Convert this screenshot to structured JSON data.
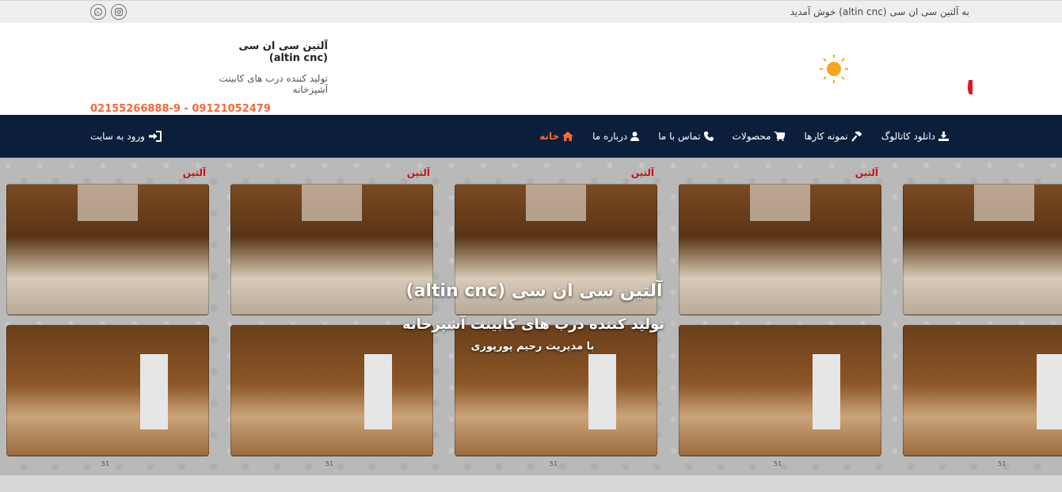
{
  "topbar": {
    "welcome": "به آلتین سی ان سی (altin cnc) خوش آمدید",
    "social": [
      {
        "icon": "instagram-icon"
      },
      {
        "icon": "whatsapp-icon"
      }
    ]
  },
  "header": {
    "logo_text": "آلتین",
    "site_name": "آلتین سی ان سی (altin cnc)",
    "tagline": "تولید کننده درب های کابینت آشپزخانه",
    "phones": "02155266888-9 - 09121052479"
  },
  "nav": {
    "items": [
      {
        "label": "خانه",
        "icon": "home-icon",
        "active": true
      },
      {
        "label": "درباره ما",
        "icon": "user-icon"
      },
      {
        "label": "تماس با ما",
        "icon": "phone-icon"
      },
      {
        "label": "محصولات",
        "icon": "cart-icon"
      },
      {
        "label": "نمونه کارها",
        "icon": "gavel-icon"
      },
      {
        "label": "دانلود کاتالوگ",
        "icon": "download-icon"
      }
    ],
    "login": "ورود به سایت"
  },
  "hero": {
    "mini_logo": "آلتین",
    "page_number": "51",
    "title": "آلتین سی ان سی (altin cnc)",
    "subtitle": "تولید کننده درب های کابینت آشپزخانه",
    "manager": "با مدیریت رحیم پورپوری"
  },
  "colors": {
    "accent": "#ff6a2f",
    "navbar": "#0b1f3d",
    "brand_red": "#e3141b",
    "phone": "#f06a3a"
  }
}
